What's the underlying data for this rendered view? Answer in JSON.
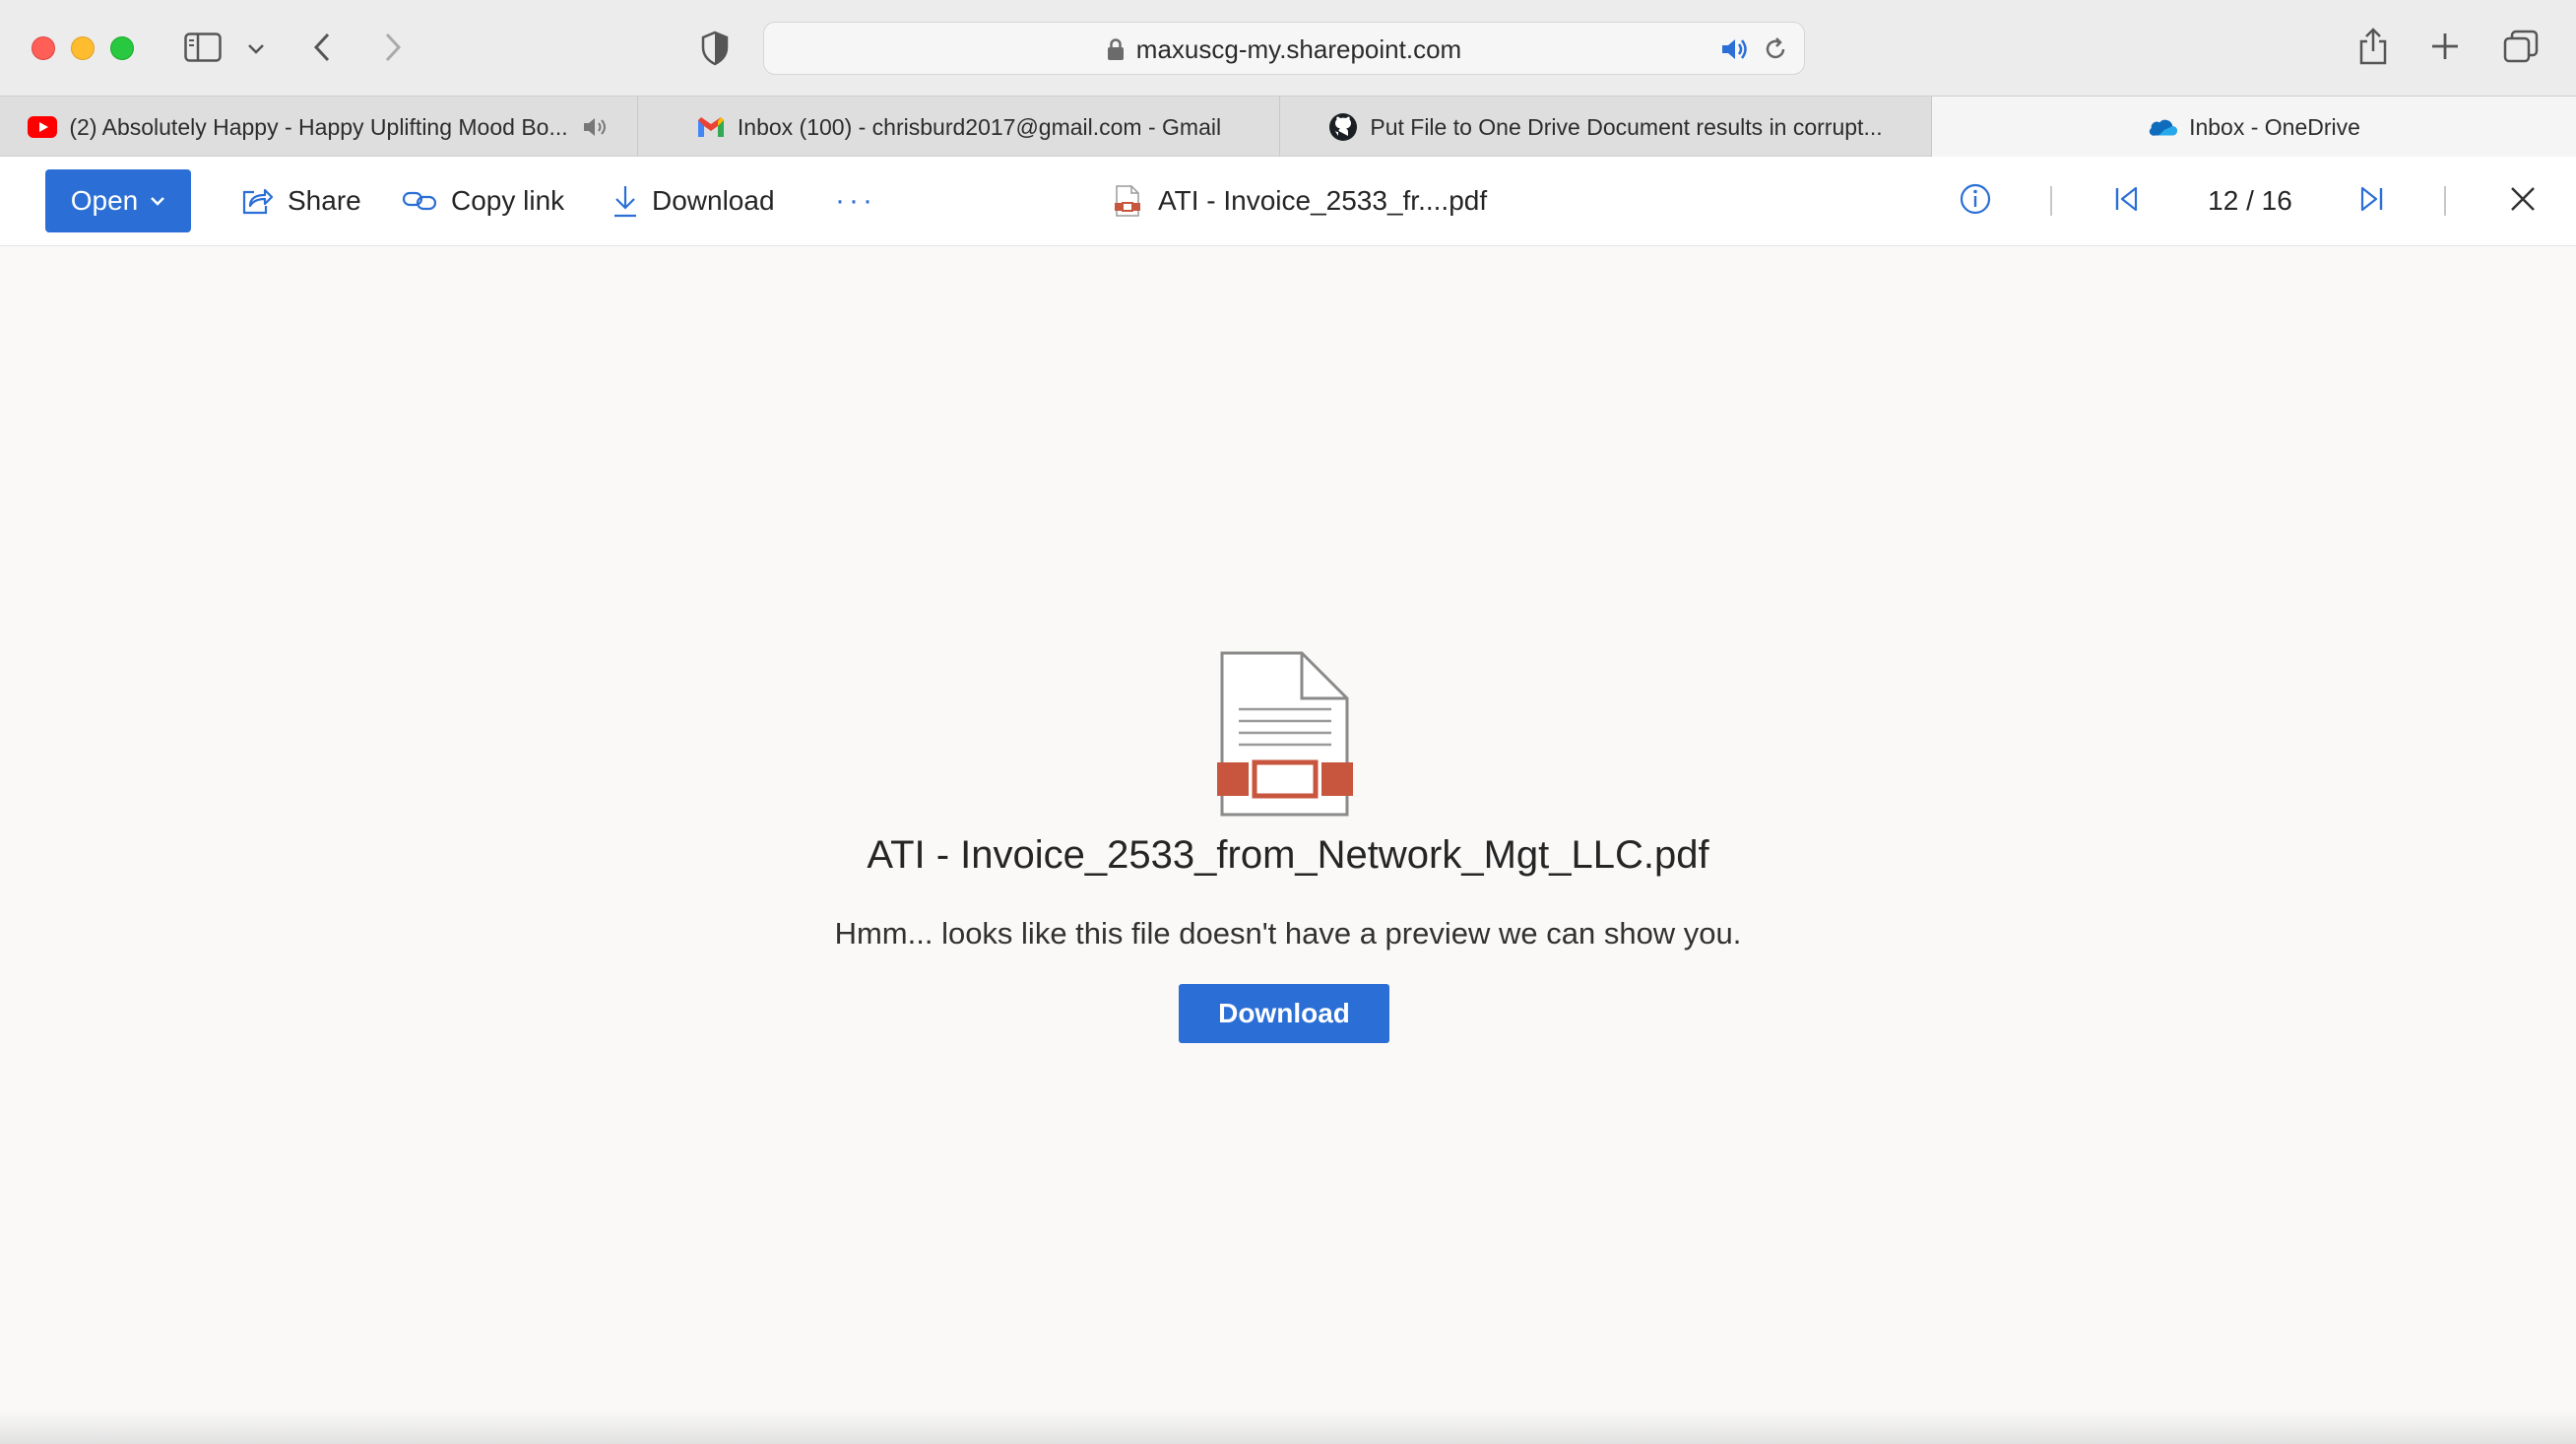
{
  "browser": {
    "url": "maxuscg-my.sharepoint.com",
    "tabs": [
      {
        "label": "(2) Absolutely Happy - Happy Uplifting Mood Bo...",
        "icon": "youtube-icon",
        "muted_icon": "speaker-icon"
      },
      {
        "label": "Inbox (100) - chrisburd2017@gmail.com - Gmail",
        "icon": "gmail-icon"
      },
      {
        "label": "Put File to One Drive Document results in corrupt...",
        "icon": "github-icon"
      },
      {
        "label": "Inbox - OneDrive",
        "icon": "onedrive-icon"
      }
    ],
    "active_tab_index": 3
  },
  "toolbar": {
    "open_label": "Open",
    "share_label": "Share",
    "copy_link_label": "Copy link",
    "download_label": "Download",
    "more_label": "···",
    "document_title": "ATI - Invoice_2533_fr....pdf",
    "page_indicator": "12 / 16"
  },
  "content": {
    "file_name": "ATI - Invoice_2533_from_Network_Mgt_LLC.pdf",
    "message": "Hmm... looks like this file doesn't have a preview we can show you.",
    "download_button": "Download"
  },
  "colors": {
    "accent": "#2b6fd6",
    "pdf_red": "#c8553d",
    "content_bg": "#faf9f8"
  }
}
